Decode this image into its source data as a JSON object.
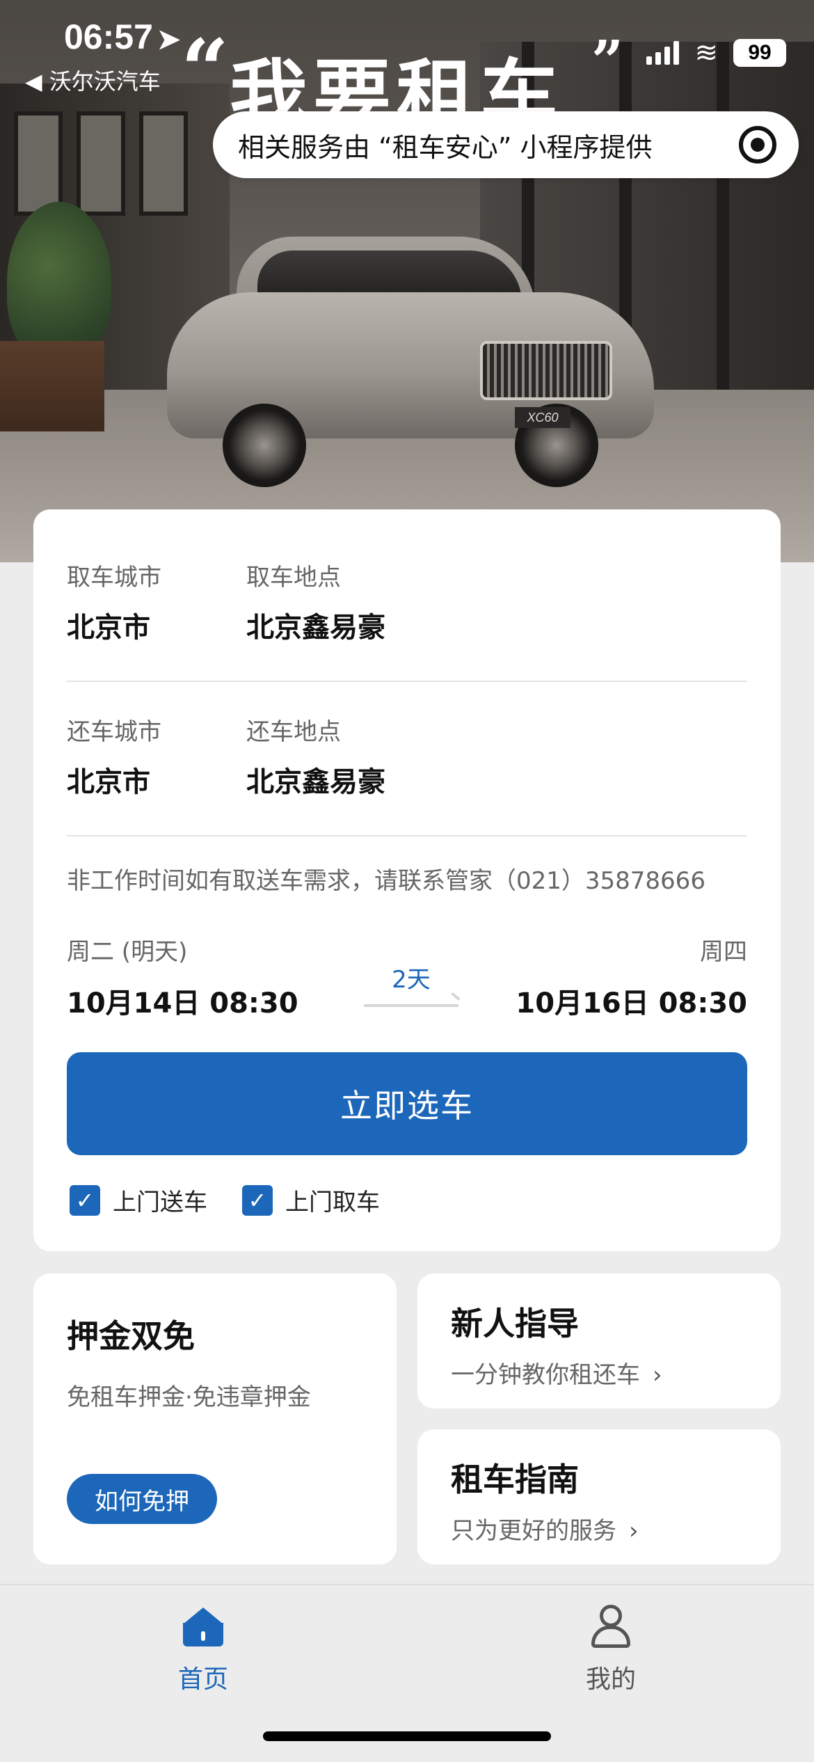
{
  "status_bar": {
    "time": "06:57",
    "back_label": "◀ 沃尔沃汽车",
    "battery": "99"
  },
  "hero": {
    "headline": "我要租车",
    "quote_open": "“",
    "quote_close": "”"
  },
  "notice": {
    "text": "相关服务由 “租车安心” 小程序提供"
  },
  "booking": {
    "pickup_city_label": "取车城市",
    "pickup_city": "北京市",
    "pickup_location_label": "取车地点",
    "pickup_location": "北京鑫易豪",
    "return_city_label": "还车城市",
    "return_city": "北京市",
    "return_location_label": "还车地点",
    "return_location": "北京鑫易豪",
    "hint": "非工作时间如有取送车需求，请联系管家（021）35878666",
    "start_weekday": "周二 (明天)",
    "start_datetime": "10月14日 08:30",
    "duration": "2天",
    "end_weekday": "周四",
    "end_datetime": "10月16日 08:30",
    "cta_label": "立即选车",
    "options": [
      {
        "label": "上门送车",
        "checked": true
      },
      {
        "label": "上门取车",
        "checked": true
      }
    ]
  },
  "promos": {
    "deposit": {
      "title": "押金双免",
      "subtitle": "免租车押金·免违章押金",
      "button": "如何免押"
    },
    "guide": {
      "title": "新人指导",
      "subtitle": "一分钟教你租还车"
    },
    "handbook": {
      "title": "租车指南",
      "subtitle": "只为更好的服务"
    }
  },
  "tabbar": {
    "home": "首页",
    "mine": "我的"
  },
  "colors": {
    "accent": "#1c67b9",
    "background": "#ececec",
    "card": "#ffffff"
  }
}
